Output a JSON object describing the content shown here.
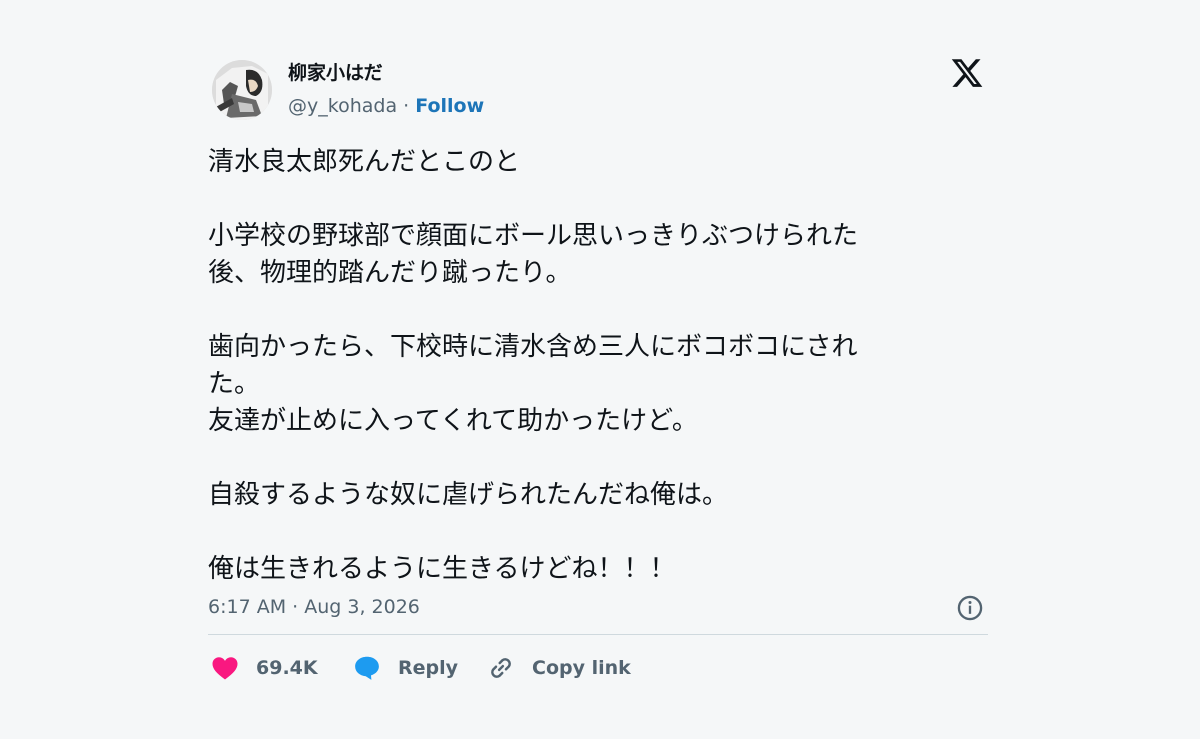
{
  "author": {
    "name": "柳家小はだ",
    "handle": "@y_kohada",
    "separator": "·",
    "follow_label": "Follow"
  },
  "platform_logo": "x-logo-icon",
  "tweet": {
    "lines": [
      "清水良太郎死んだとこのと",
      "",
      "小学校の野球部で顔面にボール思いっきりぶつけられた",
      "後、物理的踏んだり蹴ったり。",
      "",
      "歯向かったら、下校時に清水含め三人にボコボコにされ",
      "た。",
      "友達が止めに入ってくれて助かったけど。",
      "",
      "自殺するような奴に虐げられたんだね俺は。",
      "",
      "俺は生きれるように生きるけどね！！！"
    ]
  },
  "timestamp": "6:17 AM · Aug 3, 2026",
  "actions": {
    "like_count": "69.4K",
    "reply_label": "Reply",
    "copy_link_label": "Copy link"
  },
  "colors": {
    "like": "#f91880",
    "reply": "#1d9bf0",
    "follow": "#1d75b8",
    "secondary_text": "#536471",
    "background": "#f5f7f8"
  }
}
